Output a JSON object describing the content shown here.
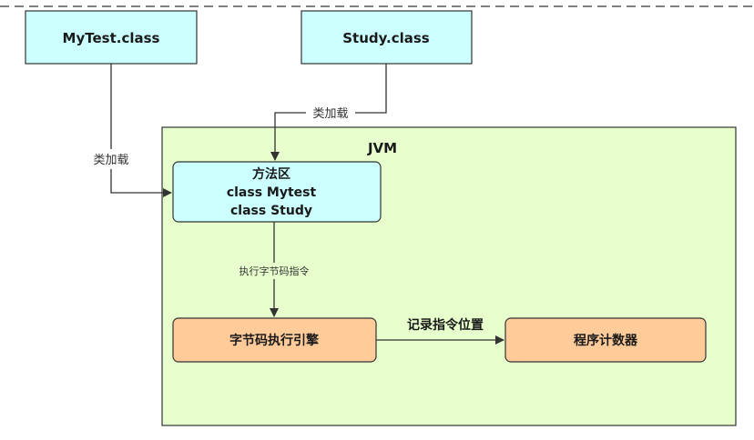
{
  "colors": {
    "class_box_fill": "#ccffff",
    "jvm_fill": "#e6ffcc",
    "orange_fill": "#ffcc99",
    "stroke": "#333333",
    "dash": "#555555"
  },
  "nodes": {
    "mytest_class": {
      "label": "MyTest.class"
    },
    "study_class": {
      "label": "Study.class"
    },
    "jvm": {
      "label": "JVM"
    },
    "method_area": {
      "line1": "方法区",
      "line2": "class Mytest",
      "line3": "class Study"
    },
    "engine": {
      "label": "字节码执行引擎"
    },
    "pc": {
      "label": "程序计数器"
    }
  },
  "edges": {
    "study_load": {
      "label": "类加载"
    },
    "mytest_load": {
      "label": "类加载"
    },
    "execute": {
      "label": "执行字节码指令"
    },
    "record": {
      "label": "记录指令位置"
    }
  }
}
